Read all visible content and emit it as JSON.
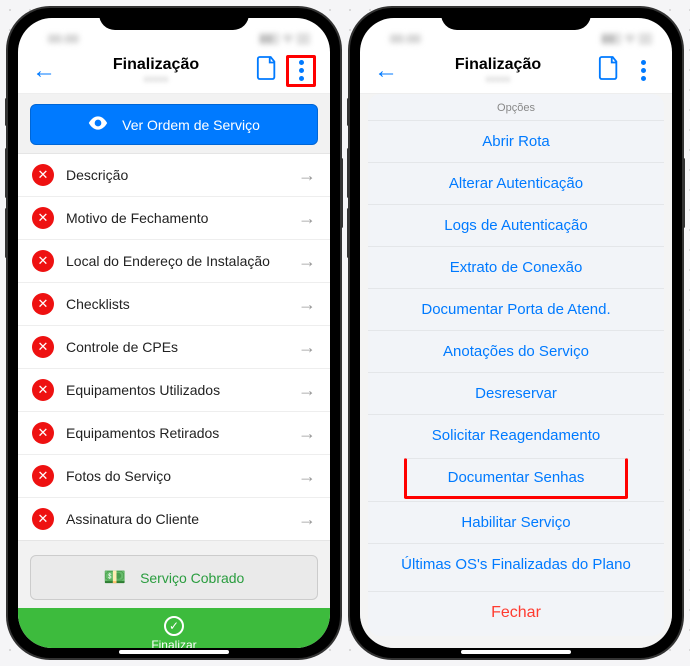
{
  "navbar": {
    "title": "Finalização",
    "subtitle_blurred": "xxxxx"
  },
  "primary_button": "Ver Ordem de Serviço",
  "items": [
    {
      "label": "Descrição"
    },
    {
      "label": "Motivo de Fechamento"
    },
    {
      "label": "Local do Endereço de Instalação"
    },
    {
      "label": "Checklists"
    },
    {
      "label": "Controle de CPEs"
    },
    {
      "label": "Equipamentos Utilizados"
    },
    {
      "label": "Equipamentos Retirados"
    },
    {
      "label": "Fotos do Serviço"
    },
    {
      "label": "Assinatura do Cliente"
    }
  ],
  "charged_button": "Serviço Cobrado",
  "finalize": "Finalizar",
  "sheet": {
    "title": "Opções",
    "items": [
      "Abrir Rota",
      "Alterar Autenticação",
      "Logs de Autenticação",
      "Extrato de Conexão",
      "Documentar Porta de Atend.",
      "Anotações do Serviço",
      "Desreservar",
      "Solicitar Reagendamento",
      "Documentar Senhas",
      "Habilitar Serviço",
      "Últimas OS's Finalizadas do Plano"
    ],
    "highlighted_index": 8,
    "cancel": "Fechar"
  }
}
